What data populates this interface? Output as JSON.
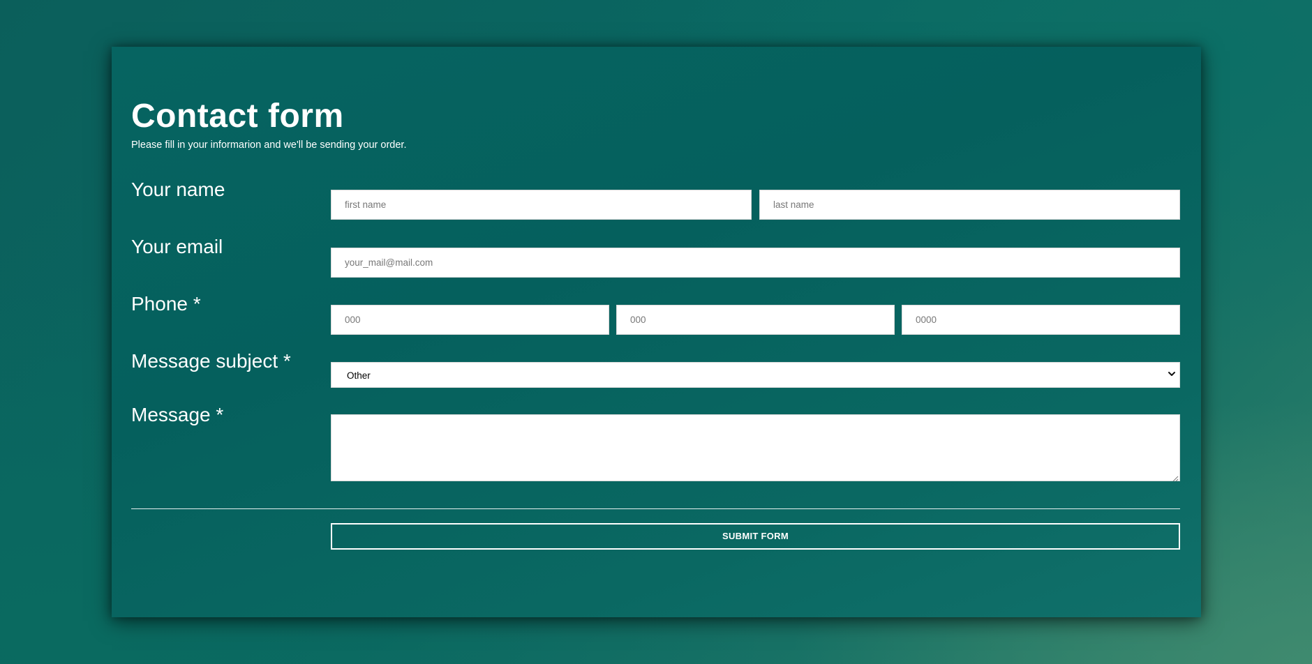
{
  "form": {
    "title": "Contact form",
    "subtitle": "Please fill in your informarion and we'll be sending your order."
  },
  "fields": {
    "name": {
      "label": "Your name",
      "first_placeholder": "first name",
      "last_placeholder": "last name",
      "first_value": "",
      "last_value": ""
    },
    "email": {
      "label": "Your email",
      "placeholder": "your_mail@mail.com",
      "value": ""
    },
    "phone": {
      "label": "Phone *",
      "area_placeholder": "000",
      "prefix_placeholder": "000",
      "line_placeholder": "0000"
    },
    "subject": {
      "label": "Message subject *",
      "selected": "Other"
    },
    "message": {
      "label": "Message *",
      "value": ""
    }
  },
  "actions": {
    "submit_label": "SUBMIT FORM"
  },
  "icons": {
    "select_chevron": "chevron-down-icon",
    "textarea_resize": "resize-grip-icon"
  },
  "colors": {
    "card_background": "#066461",
    "page_background": "#0b5f5b",
    "text": "#ffffff",
    "input_background": "#ffffff"
  }
}
